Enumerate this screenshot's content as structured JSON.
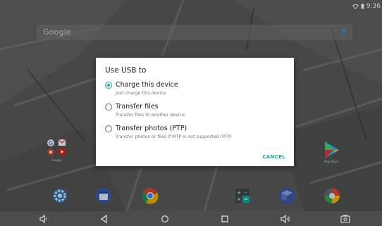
{
  "status_bar": {
    "time": "9:36"
  },
  "search": {
    "logo_text": "Google"
  },
  "dialog": {
    "title": "Use USB to",
    "options": [
      {
        "label": "Charge this device",
        "description": "Just charge this device",
        "selected": true
      },
      {
        "label": "Transfer files",
        "description": "Transfer files to another device",
        "selected": false
      },
      {
        "label": "Transfer photos (PTP)",
        "description": "Transfer photos or files if MTP is not supported (PTP)",
        "selected": false
      }
    ],
    "cancel_label": "CANCEL"
  },
  "desktop": {
    "folder_label": "Google",
    "playstore_label": "Play Store"
  },
  "dock": {
    "items": [
      "settings-icon",
      "calendar-icon",
      "chrome-icon",
      "calculator-icon",
      "box-icon",
      "photos-icon"
    ]
  },
  "nav_bar": {
    "items": [
      "volume-down-icon",
      "back-icon",
      "home-icon",
      "recents-icon",
      "volume-up-icon",
      "screenshot-icon"
    ]
  },
  "colors": {
    "accent": "#1aa69a",
    "dialog_bg": "#ffffff",
    "nav_bg": "#4b4c4c"
  }
}
